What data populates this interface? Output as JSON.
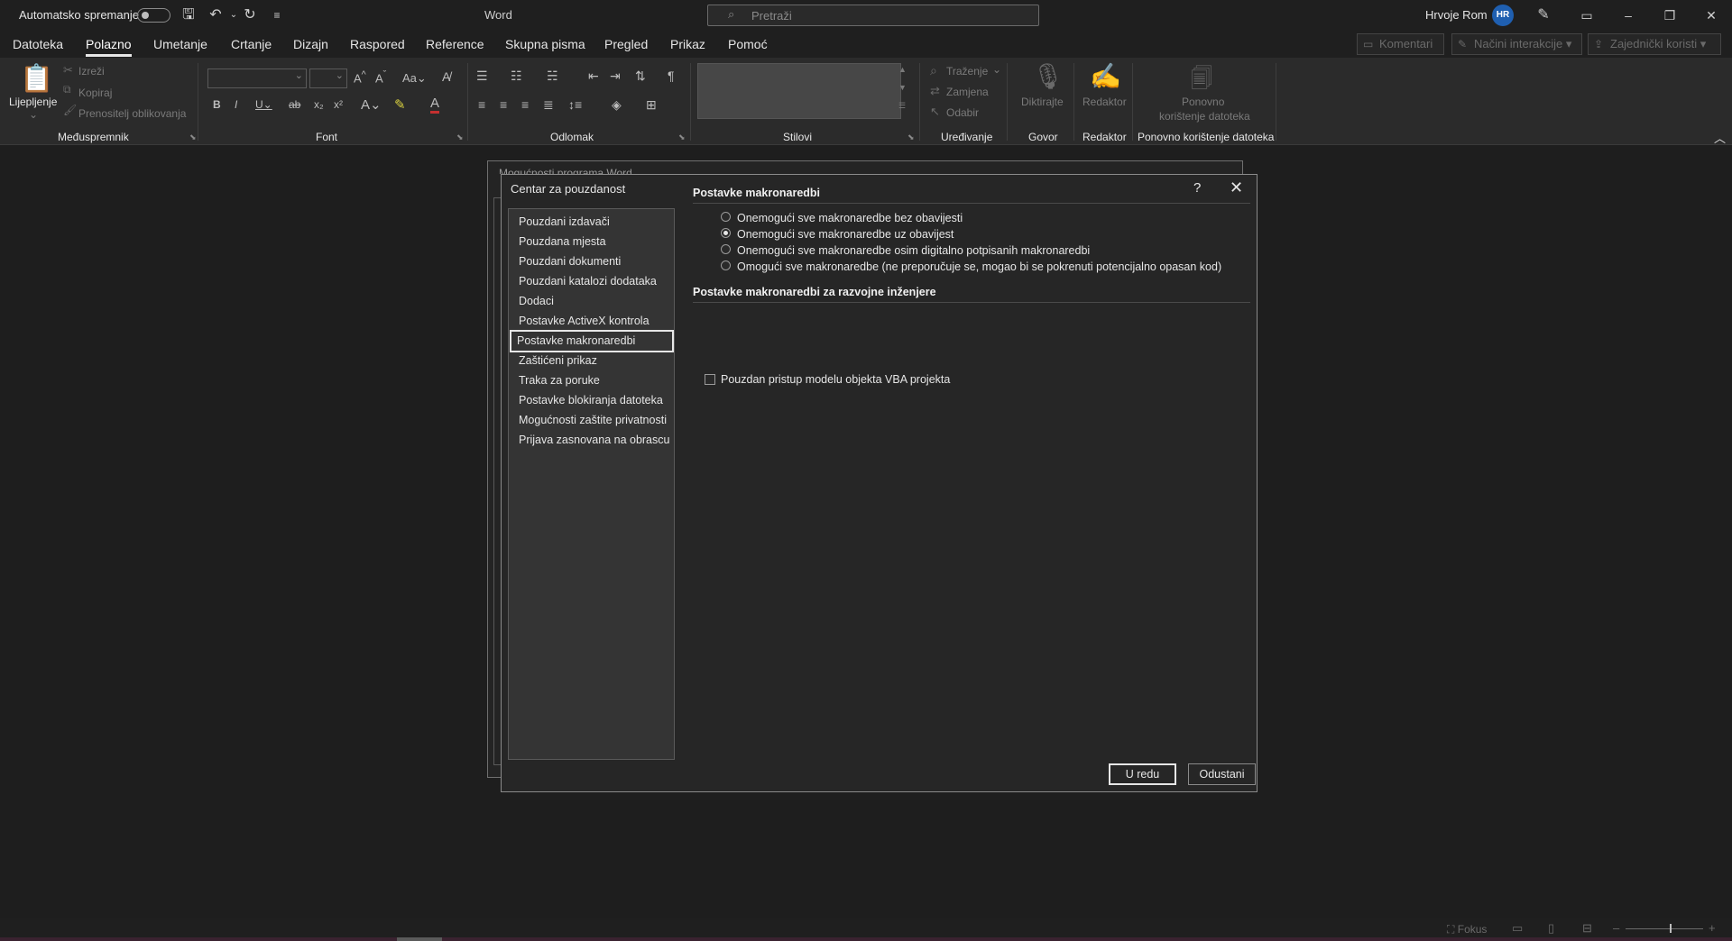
{
  "titlebar": {
    "autosave_label": "Automatsko spremanje",
    "app_title": "Word",
    "search_placeholder": "Pretraži",
    "user_name": "Hrvoje Rom",
    "user_initials": "HR"
  },
  "menu": {
    "tabs": [
      "Datoteka",
      "Polazno",
      "Umetanje",
      "Crtanje",
      "Dizajn",
      "Raspored",
      "Reference",
      "Skupna pisma",
      "Pregled",
      "Prikaz",
      "Pomoć"
    ],
    "active_tab": "Polazno",
    "comments_label": "Komentari",
    "interaction_label": "Načini interakcije",
    "share_label": "Zajednički koristi"
  },
  "ribbon": {
    "clipboard": {
      "paste_label": "Lijepljenje",
      "cut_label": "Izreži",
      "copy_label": "Kopiraj",
      "format_painter_label": "Prenositelj oblikovanja",
      "group_label": "Međuspremnik"
    },
    "font": {
      "group_label": "Font"
    },
    "paragraph": {
      "group_label": "Odlomak"
    },
    "styles": {
      "group_label": "Stilovi"
    },
    "editing": {
      "find_label": "Traženje",
      "replace_label": "Zamjena",
      "select_label": "Odabir",
      "group_label": "Uređivanje"
    },
    "voice": {
      "dictate_label": "Diktirajte",
      "group_label": "Govor"
    },
    "editor": {
      "editor_label": "Redaktor",
      "group_label": "Redaktor"
    },
    "reuse": {
      "reuse_label_1": "Ponovno",
      "reuse_label_2": "korištenje datoteka",
      "group_label": "Ponovno korištenje datoteka"
    }
  },
  "bg_dialog": {
    "title": "Mogućnosti programa Word"
  },
  "dialog": {
    "title": "Centar za pouzdanost",
    "help": "?",
    "nav_items": [
      "Pouzdani izdavači",
      "Pouzdana mjesta",
      "Pouzdani dokumenti",
      "Pouzdani katalozi dodataka",
      "Dodaci",
      "Postavke ActiveX kontrola",
      "Postavke makronaredbi",
      "Zaštićeni prikaz",
      "Traka za poruke",
      "Postavke blokiranja datoteka",
      "Mogućnosti zaštite privatnosti",
      "Prijava zasnovana na obrascu"
    ],
    "selected_nav": "Postavke makronaredbi",
    "section1_title": "Postavke makronaredbi",
    "options": [
      {
        "label": "Onemogući sve makronaredbe bez obavijesti",
        "checked": false
      },
      {
        "label": "Onemogući sve makronaredbe uz obavijest",
        "checked": true
      },
      {
        "label": "Onemogući sve makronaredbe osim digitalno potpisanih makronaredbi",
        "checked": false
      },
      {
        "label": "Omogući sve makronaredbe (ne preporučuje se, mogao bi se pokrenuti potencijalno opasan kod)",
        "checked": false
      }
    ],
    "section2_title": "Postavke makronaredbi za razvojne inženjere",
    "vba_label": "Pouzdan pristup modelu objekta VBA projekta",
    "vba_checked": false,
    "ok_label": "U redu",
    "cancel_label": "Odustani"
  },
  "statusbar": {
    "focus_label": "Fokus"
  }
}
